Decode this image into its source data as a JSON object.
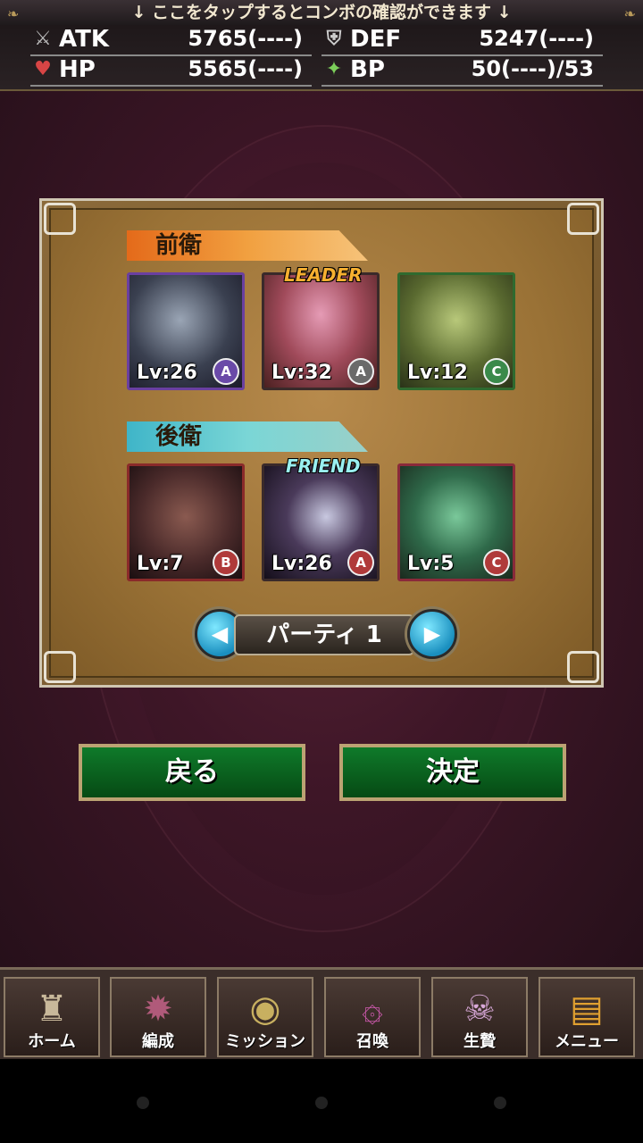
{
  "header": {
    "hint": "↓ ここをタップするとコンボの確認ができます ↓",
    "stats": [
      {
        "icon": "sword-icon",
        "label": "ATK",
        "value": "5765(----)"
      },
      {
        "icon": "shield-icon",
        "label": "DEF",
        "value": "5247(----)"
      },
      {
        "icon": "heart-icon",
        "label": "HP",
        "value": "5565(----)"
      },
      {
        "icon": "bp-icon",
        "label": "BP",
        "value": "50(----)/53"
      }
    ]
  },
  "party": {
    "front_label": "前衛",
    "back_label": "後衛",
    "front": [
      {
        "level": "Lv:26",
        "rank": "A",
        "tag": ""
      },
      {
        "level": "Lv:32",
        "rank": "A",
        "tag": "LEADER"
      },
      {
        "level": "Lv:12",
        "rank": "C",
        "tag": ""
      }
    ],
    "back": [
      {
        "level": "Lv:7",
        "rank": "B",
        "tag": ""
      },
      {
        "level": "Lv:26",
        "rank": "A",
        "tag": "FRIEND"
      },
      {
        "level": "Lv:5",
        "rank": "C",
        "tag": ""
      }
    ],
    "selector_label": "パーティ 1"
  },
  "buttons": {
    "back": "戻る",
    "confirm": "決定"
  },
  "nav": [
    {
      "icon": "castle-icon",
      "label": "ホーム"
    },
    {
      "icon": "dragon-icon",
      "label": "編成"
    },
    {
      "icon": "globe-icon",
      "label": "ミッション"
    },
    {
      "icon": "portal-icon",
      "label": "召喚"
    },
    {
      "icon": "skull-icon",
      "label": "生贄"
    },
    {
      "icon": "book-icon",
      "label": "メニュー"
    }
  ]
}
